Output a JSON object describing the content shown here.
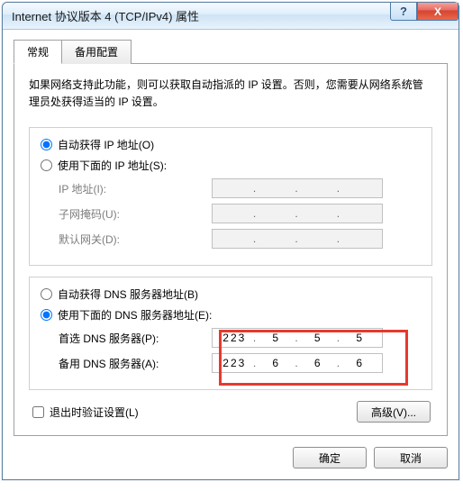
{
  "window": {
    "title": "Internet 协议版本 4 (TCP/IPv4) 属性",
    "help_icon": "?",
    "close_icon": "X"
  },
  "tabs": {
    "general": "常规",
    "alternate": "备用配置"
  },
  "description": "如果网络支持此功能，则可以获取自动指派的 IP 设置。否则，您需要从网络系统管理员处获得适当的 IP 设置。",
  "ip_section": {
    "auto_label": "自动获得 IP 地址(O)",
    "manual_label": "使用下面的 IP 地址(S):",
    "ip_address_label": "IP 地址(I):",
    "subnet_label": "子网掩码(U):",
    "gateway_label": "默认网关(D):",
    "auto_selected": true
  },
  "dns_section": {
    "auto_label": "自动获得 DNS 服务器地址(B)",
    "manual_label": "使用下面的 DNS 服务器地址(E):",
    "preferred_label": "首选 DNS 服务器(P):",
    "alternate_label": "备用 DNS 服务器(A):",
    "manual_selected": true,
    "preferred": {
      "o1": "223",
      "o2": "5",
      "o3": "5",
      "o4": "5"
    },
    "alternate": {
      "o1": "223",
      "o2": "6",
      "o3": "6",
      "o4": "6"
    }
  },
  "validate_on_exit": "退出时验证设置(L)",
  "buttons": {
    "advanced": "高级(V)...",
    "ok": "确定",
    "cancel": "取消"
  },
  "dot": "."
}
